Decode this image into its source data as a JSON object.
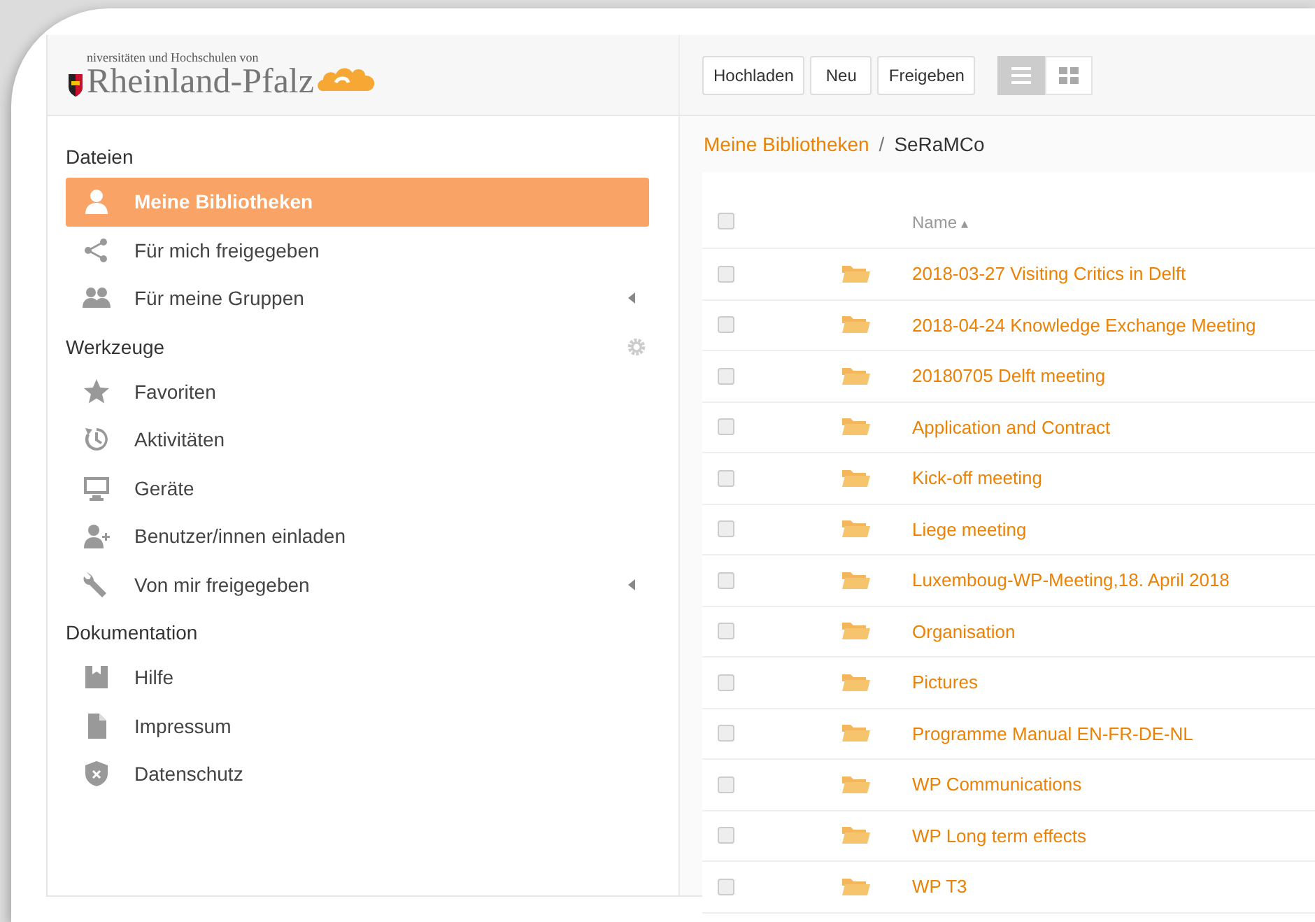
{
  "logo": {
    "subtitle": "niversitäten und Hochschulen von",
    "title": "Rheinland-Pfalz"
  },
  "toolbar": {
    "buttons": [
      "Hochladen",
      "Neu",
      "Freigeben"
    ],
    "views": [
      {
        "kind": "list",
        "selected": true
      },
      {
        "kind": "grid",
        "selected": false
      }
    ]
  },
  "sidebar": {
    "sections": [
      {
        "title": "Dateien",
        "has_settings": false,
        "items": [
          {
            "label": "Meine Bibliotheken",
            "selected": true,
            "has_submenu": false
          },
          {
            "label": "Für mich freigegeben",
            "selected": false,
            "has_submenu": false
          },
          {
            "label": "Für meine Gruppen",
            "selected": false,
            "has_submenu": true
          }
        ]
      },
      {
        "title": "Werkzeuge",
        "has_settings": true,
        "items": [
          {
            "label": "Favoriten",
            "selected": false,
            "has_submenu": false
          },
          {
            "label": "Aktivitäten",
            "selected": false,
            "has_submenu": false
          },
          {
            "label": "Geräte",
            "selected": false,
            "has_submenu": false
          },
          {
            "label": "Benutzer/innen einladen",
            "selected": false,
            "has_submenu": false
          },
          {
            "label": "Von mir freigegeben",
            "selected": false,
            "has_submenu": true
          }
        ]
      },
      {
        "title": "Dokumentation",
        "has_settings": false,
        "items": [
          {
            "label": "Hilfe",
            "selected": false,
            "has_submenu": false
          },
          {
            "label": "Impressum",
            "selected": false,
            "has_submenu": false
          },
          {
            "label": "Datenschutz",
            "selected": false,
            "has_submenu": false
          }
        ]
      }
    ]
  },
  "breadcrumb": {
    "link": "Meine Bibliotheken",
    "separator": "/",
    "current": "SeRaMCo"
  },
  "table": {
    "header": {
      "checked": false,
      "name": "Name",
      "sort_mark": "▴"
    },
    "rows": [
      {
        "name": "2018-03-27 Visiting Critics in Delft",
        "checked": false
      },
      {
        "name": "2018-04-24 Knowledge Exchange Meeting",
        "checked": false
      },
      {
        "name": "20180705 Delft meeting",
        "checked": false
      },
      {
        "name": "Application and Contract",
        "checked": false
      },
      {
        "name": "Kick-off meeting",
        "checked": false
      },
      {
        "name": "Liege meeting",
        "checked": false
      },
      {
        "name": "Luxemboug-WP-Meeting,18. April 2018",
        "checked": false
      },
      {
        "name": "Organisation",
        "checked": false
      },
      {
        "name": "Pictures",
        "checked": false
      },
      {
        "name": "Programme Manual EN-FR-DE-NL",
        "checked": false
      },
      {
        "name": "WP Communications",
        "checked": false
      },
      {
        "name": "WP Long term effects",
        "checked": false
      },
      {
        "name": "WP T3",
        "checked": false
      }
    ]
  }
}
